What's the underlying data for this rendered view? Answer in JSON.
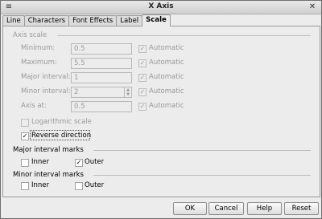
{
  "window": {
    "title": "X Axis",
    "close_glyph": "✕",
    "menu_glyph": "≡"
  },
  "tabs": [
    "Line",
    "Characters",
    "Font Effects",
    "Label",
    "Scale"
  ],
  "active_tab": "Scale",
  "axis_scale": {
    "heading": "Axis scale",
    "rows": [
      {
        "label": "Minimum:",
        "value": "0.5",
        "auto_label": "Automatic",
        "auto": true
      },
      {
        "label": "Maximum:",
        "value": "5.5",
        "auto_label": "Automatic",
        "auto": true
      },
      {
        "label": "Major interval:",
        "value": "1",
        "auto_label": "Automatic",
        "auto": true
      },
      {
        "label": "Minor interval:",
        "value": "2",
        "auto_label": "Automatic",
        "auto": true
      },
      {
        "label": "Axis at:",
        "value": "0.5",
        "auto_label": "Automatic",
        "auto": true
      }
    ],
    "logarithmic_label": "Logarithmic scale",
    "logarithmic": false,
    "reverse_label": "Reverse direction",
    "reverse": true
  },
  "major_marks": {
    "heading": "Major interval marks",
    "inner_label": "Inner",
    "inner": false,
    "outer_label": "Outer",
    "outer": true
  },
  "minor_marks": {
    "heading": "Minor interval marks",
    "inner_label": "Inner",
    "inner": false,
    "outer_label": "Outer",
    "outer": false
  },
  "buttons": {
    "ok": "OK",
    "cancel": "Cancel",
    "help": "Help",
    "reset": "Reset"
  },
  "check_glyph": "✓"
}
